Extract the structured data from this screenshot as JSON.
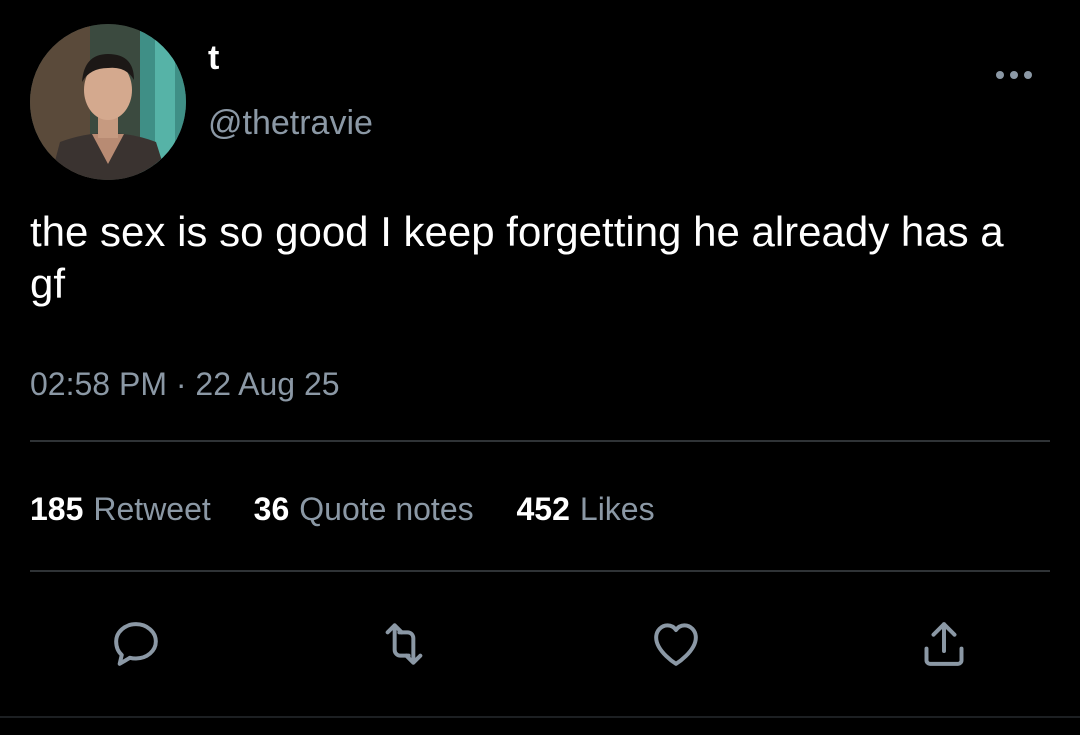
{
  "author": {
    "display_name": "t",
    "handle": "@thetravie"
  },
  "tweet": {
    "text": "the sex is so good I keep forgetting he already has a gf",
    "time": "02:58 PM",
    "separator": "·",
    "date": "22 Aug 25"
  },
  "stats": [
    {
      "count": "185",
      "label": "Retweet"
    },
    {
      "count": "36",
      "label": "Quote notes"
    },
    {
      "count": "452",
      "label": "Likes"
    }
  ],
  "icons": {
    "more": "more-horizontal-icon",
    "reply": "reply-icon",
    "retweet": "retweet-icon",
    "like": "heart-icon",
    "share": "share-icon"
  },
  "colors": {
    "background": "#000000",
    "primary_text": "#ffffff",
    "secondary_text": "#8b98a5",
    "divider": "#2f3336"
  }
}
